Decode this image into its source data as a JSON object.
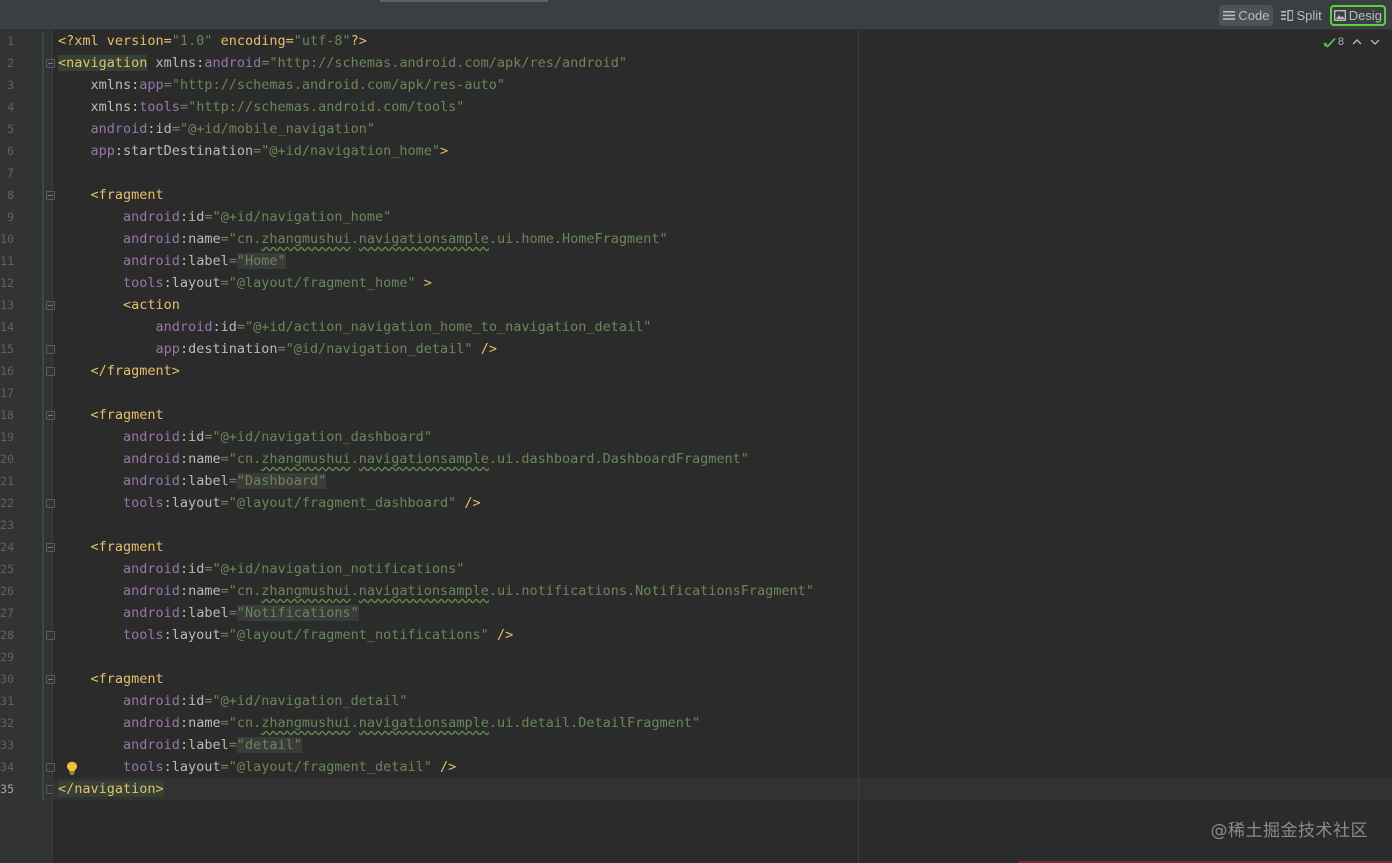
{
  "view_modes": {
    "code_label": "Code",
    "split_label": "Split",
    "design_label": "Desig"
  },
  "inspection": {
    "count": "8"
  },
  "watermark": "@稀土掘金技术社区",
  "line_numbers": [
    "1",
    "2",
    "3",
    "4",
    "5",
    "6",
    "7",
    "8",
    "9",
    "10",
    "11",
    "12",
    "13",
    "14",
    "15",
    "16",
    "17",
    "18",
    "19",
    "20",
    "21",
    "22",
    "23",
    "24",
    "25",
    "26",
    "27",
    "28",
    "29",
    "30",
    "31",
    "32",
    "33",
    "34",
    "35"
  ],
  "code": {
    "l1_a": "<?xml version=",
    "l1_b": "\"1.0\"",
    "l1_c": " encoding=",
    "l1_d": "\"utf-8\"",
    "l1_e": "?>",
    "l2_tag": "<navigation",
    "l2_xmlns": " xmlns:",
    "l2_ns": "android",
    "l2_eq": "=",
    "l2_val": "\"http://schemas.android.com/apk/res/android\"",
    "l3_xmlns": "xmlns:",
    "l3_ns": "app",
    "l3_eq": "=",
    "l3_val": "\"http://schemas.android.com/apk/res-auto\"",
    "l4_xmlns": "xmlns:",
    "l4_ns": "tools",
    "l4_eq": "=",
    "l4_val": "\"http://schemas.android.com/tools\"",
    "l5_ns": "android",
    "l5_attr": ":id",
    "l5_eq": "=",
    "l5_val": "\"@+id/mobile_navigation\"",
    "l6_ns": "app",
    "l6_attr": ":startDestination",
    "l6_eq": "=",
    "l6_val": "\"@+id/navigation_home\"",
    "l6_end": ">",
    "l8_tag": "<fragment",
    "l9_ns": "android",
    "l9_attr": ":id",
    "l9_eq": "=",
    "l9_val": "\"@+id/navigation_home\"",
    "l10_ns": "android",
    "l10_attr": ":name",
    "l10_eq": "=",
    "l10_q1": "\"cn.",
    "l10_t1": "zhangmushui",
    "l10_dot": ".",
    "l10_t2": "navigationsample",
    "l10_rest": ".ui.home.HomeFragment\"",
    "l11_ns": "android",
    "l11_attr": ":label",
    "l11_eq": "=",
    "l11_val": "\"Home\"",
    "l12_ns": "tools",
    "l12_attr": ":layout",
    "l12_eq": "=",
    "l12_val": "\"@layout/fragment_home\"",
    "l12_end": " >",
    "l13_tag": "<action",
    "l14_ns": "android",
    "l14_attr": ":id",
    "l14_eq": "=",
    "l14_val": "\"@+id/action_navigation_home_to_navigation_detail\"",
    "l15_ns": "app",
    "l15_attr": ":destination",
    "l15_eq": "=",
    "l15_val": "\"@id/navigation_detail\"",
    "l15_end": " />",
    "l16_tag": "</fragment>",
    "l18_tag": "<fragment",
    "l19_ns": "android",
    "l19_attr": ":id",
    "l19_eq": "=",
    "l19_val": "\"@+id/navigation_dashboard\"",
    "l20_ns": "android",
    "l20_attr": ":name",
    "l20_eq": "=",
    "l20_q1": "\"cn.",
    "l20_t1": "zhangmushui",
    "l20_dot": ".",
    "l20_t2": "navigationsample",
    "l20_rest": ".ui.dashboard.DashboardFragment\"",
    "l21_ns": "android",
    "l21_attr": ":label",
    "l21_eq": "=",
    "l21_val": "\"Dashboard\"",
    "l22_ns": "tools",
    "l22_attr": ":layout",
    "l22_eq": "=",
    "l22_val": "\"@layout/fragment_dashboard\"",
    "l22_end": " />",
    "l24_tag": "<fragment",
    "l25_ns": "android",
    "l25_attr": ":id",
    "l25_eq": "=",
    "l25_val": "\"@+id/navigation_notifications\"",
    "l26_ns": "android",
    "l26_attr": ":name",
    "l26_eq": "=",
    "l26_q1": "\"cn.",
    "l26_t1": "zhangmushui",
    "l26_dot": ".",
    "l26_t2": "navigationsample",
    "l26_rest": ".ui.notifications.NotificationsFragment\"",
    "l27_ns": "android",
    "l27_attr": ":label",
    "l27_eq": "=",
    "l27_val": "\"Notifications\"",
    "l28_ns": "tools",
    "l28_attr": ":layout",
    "l28_eq": "=",
    "l28_val": "\"@layout/fragment_notifications\"",
    "l28_end": " />",
    "l30_tag": "<fragment",
    "l31_ns": "android",
    "l31_attr": ":id",
    "l31_eq": "=",
    "l31_val": "\"@+id/navigation_detail\"",
    "l32_ns": "android",
    "l32_attr": ":name",
    "l32_eq": "=",
    "l32_q1": "\"cn.",
    "l32_t1": "zhangmushui",
    "l32_dot": ".",
    "l32_t2": "navigationsample",
    "l32_rest": ".ui.detail.DetailFragment\"",
    "l33_ns": "android",
    "l33_attr": ":label",
    "l33_eq": "=",
    "l33_val": "\"detail\"",
    "l34_ns": "tools",
    "l34_attr": ":layout",
    "l34_eq": "=",
    "l34_val": "\"@layout/fragment_detail\"",
    "l34_end": " />",
    "l35_tag": "</navigation>"
  },
  "colors": {
    "background": "#2b2b2b",
    "tag": "#e8bf6a",
    "namespace": "#9876aa",
    "string": "#6a8759",
    "attribute": "#bababa",
    "design_highlight": "#59d23c"
  },
  "icons": {
    "code_mode": "lines-icon",
    "split_mode": "split-icon",
    "design_mode": "image-icon",
    "inspection": "check-icon",
    "prev": "chevron-up-icon",
    "next": "chevron-down-icon",
    "intention": "lightbulb-icon"
  }
}
